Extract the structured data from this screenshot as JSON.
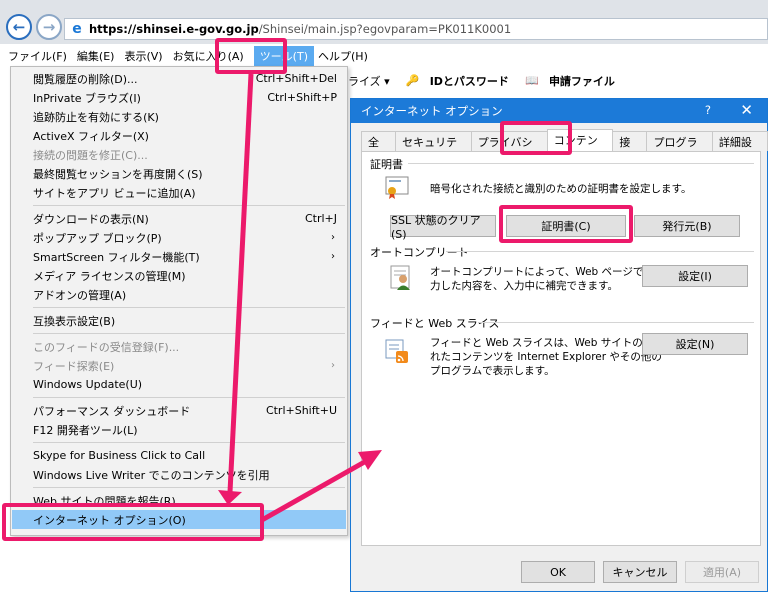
{
  "browser": {
    "url_host": "https://shinsei.e-gov.go.jp",
    "url_path": "/Shinsei/main.jsp?egovparam=PK011K0001",
    "back_glyph": "←",
    "forward_glyph": "→"
  },
  "menubar": {
    "items": [
      "ファイル(F)",
      "編集(E)",
      "表示(V)",
      "お気に入り(A)",
      "ツール(T)",
      "ヘルプ(H)"
    ]
  },
  "toolbar": {
    "item0": "ライズ ▾",
    "item1": "IDとパスワード",
    "item2": "申請ファイル"
  },
  "tools_menu": {
    "items": [
      {
        "label": "閲覧履歴の削除(D)...",
        "shortcut": "Ctrl+Shift+Del"
      },
      {
        "label": "InPrivate ブラウズ(I)",
        "shortcut": "Ctrl+Shift+P"
      },
      {
        "label": "追跡防止を有効にする(K)",
        "shortcut": ""
      },
      {
        "label": "ActiveX フィルター(X)",
        "shortcut": ""
      },
      {
        "label": "接続の問題を修正(C)...",
        "shortcut": ""
      },
      {
        "label": "最終閲覧セッションを再度開く(S)",
        "shortcut": ""
      },
      {
        "label": "サイトをアプリ ビューに追加(A)",
        "shortcut": ""
      },
      {
        "label": "ダウンロードの表示(N)",
        "shortcut": "Ctrl+J"
      },
      {
        "label": "ポップアップ ブロック(P)",
        "shortcut": ""
      },
      {
        "label": "SmartScreen フィルター機能(T)",
        "shortcut": ""
      },
      {
        "label": "メディア ライセンスの管理(M)",
        "shortcut": ""
      },
      {
        "label": "アドオンの管理(A)",
        "shortcut": ""
      },
      {
        "label": "互換表示設定(B)",
        "shortcut": ""
      },
      {
        "label": "このフィードの受信登録(F)...",
        "shortcut": ""
      },
      {
        "label": "フィード探索(E)",
        "shortcut": ""
      },
      {
        "label": "Windows Update(U)",
        "shortcut": ""
      },
      {
        "label": "パフォーマンス ダッシュボード",
        "shortcut": "Ctrl+Shift+U"
      },
      {
        "label": "F12 開発者ツール(L)",
        "shortcut": ""
      },
      {
        "label": "Skype for Business Click to Call",
        "shortcut": ""
      },
      {
        "label": "Windows Live Writer でこのコンテンツを引用",
        "shortcut": ""
      },
      {
        "label": "Web サイトの問題を報告(R)",
        "shortcut": ""
      },
      {
        "label": "インターネット オプション(O)",
        "shortcut": ""
      }
    ]
  },
  "dialog": {
    "title": "インターネット オプション",
    "help": "?",
    "close": "✕",
    "tabs": [
      "全般",
      "セキュリティ",
      "プライバシー",
      "コンテンツ",
      "接続",
      "プログラム",
      "詳細設定"
    ],
    "cert": {
      "heading": "証明書",
      "desc": "暗号化された接続と識別のための証明書を設定します。",
      "btn_ssl": "SSL 状態のクリア(S)",
      "btn_cert": "証明書(C)",
      "btn_publisher": "発行元(B)"
    },
    "autocomplete": {
      "heading": "オートコンプリート",
      "desc1": "オートコンプリートによって、Web ページで前回入",
      "desc2": "力した内容を、入力中に補完できます。",
      "btn": "設定(I)"
    },
    "feeds": {
      "heading": "フィードと Web スライス",
      "desc1": "フィードと Web スライスは、Web サイトの更新さ",
      "desc2": "れたコンテンツを Internet Explorer やその他の",
      "desc3": "プログラムで表示します。",
      "btn": "設定(N)"
    },
    "ok": "OK",
    "cancel": "キャンセル",
    "apply": "適用(A)"
  }
}
